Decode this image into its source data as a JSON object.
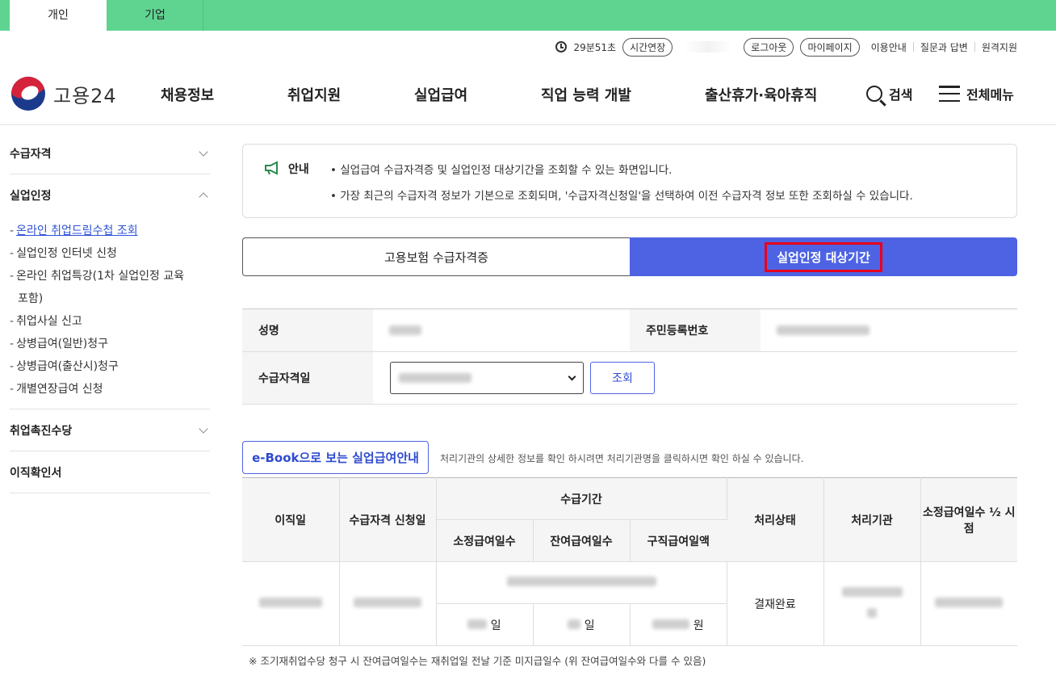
{
  "top_tabs": [
    {
      "label": "개인"
    },
    {
      "label": "기업"
    }
  ],
  "util": {
    "timer": "29분51초",
    "extend": "시간연장",
    "logout": "로그아웃",
    "mypage": "마이페이지",
    "links": [
      "이용안내",
      "질문과 답변",
      "원격지원"
    ]
  },
  "logo": {
    "text": "고용24"
  },
  "gnb": [
    "채용정보",
    "취업지원",
    "실업급여",
    "직업 능력 개발",
    "출산휴가·육아휴직"
  ],
  "search_label": "검색",
  "allmenu_label": "전체메뉴",
  "sidebar": {
    "groups": [
      "수급자격",
      "실업인정",
      "취업촉진수당",
      "이직확인서"
    ],
    "sub": [
      "온라인 취업드림수첩 조회",
      "실업인정 인터넷 신청",
      "온라인 취업특강(1차 실업인정 교육",
      "포함)",
      "취업사실 신고",
      "상병급여(일반)청구",
      "상병급여(출산시)청구",
      "개별연장급여 신청"
    ]
  },
  "notice": {
    "title": "안내",
    "lines": [
      "• 실업급여 수급자격증 및 실업인정 대상기간을 조회할 수 있는 화면입니다.",
      "• 가장 최근의 수급자격 정보가 기본으로 조회되며, '수급자격신청일'을 선택하여 이전 수급자격 정보 또한 조회하실 수 있습니다."
    ]
  },
  "tabs": [
    {
      "label": "고용보험 수급자격증"
    },
    {
      "label": "실업인정 대상기간"
    }
  ],
  "info": {
    "name_label": "성명",
    "rrn_label": "주민등록번호",
    "date_label": "수급자격일",
    "query_btn": "조회"
  },
  "ebook": {
    "label": "e-Book으로 보는 실업급여안내",
    "note": "처리기관의 상세한 정보를 확인 하시려면 처리기관명을 클릭하시면 확인 하실 수 있습니다."
  },
  "table": {
    "headers": [
      "이직일",
      "수급자격 신청일",
      "수급기간",
      "처리상태",
      "처리기관",
      "소정급여일수 ½ 시점"
    ],
    "sub_headers": [
      "소정급여일수",
      "잔여급여일수",
      "구직급여일액"
    ],
    "row": {
      "status": "결재완료",
      "unit_day": "일",
      "unit_won": "원"
    }
  },
  "footnote": "※ 조기재취업수당 청구 시 잔여급여일수는 재취업일 전날 기준 미지급일수 (위 잔여급여일수와 다를 수 있음)",
  "colors": {
    "green": "#5fd491",
    "blue": "#4d63e3",
    "red": "#e8001a"
  }
}
